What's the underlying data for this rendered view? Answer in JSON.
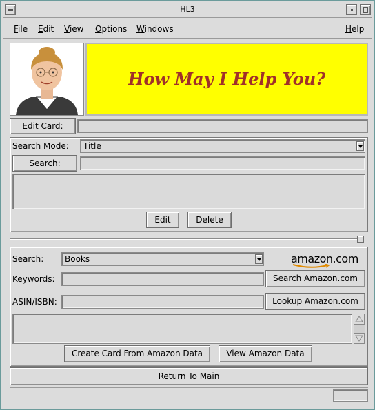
{
  "window": {
    "title": "HL3"
  },
  "menu": {
    "file": "File",
    "edit": "Edit",
    "view": "View",
    "options": "Options",
    "windows": "Windows",
    "help": "Help"
  },
  "banner": {
    "text": "How May I Help You?",
    "bg_color": "#ffff00",
    "text_color": "#a0302a"
  },
  "edit_card": {
    "button_label": "Edit Card:",
    "value": ""
  },
  "search_panel": {
    "mode_label": "Search Mode:",
    "mode_selected": "Title",
    "search_button": "Search:",
    "search_value": "",
    "edit_button": "Edit",
    "delete_button": "Delete"
  },
  "amazon_panel": {
    "search_label": "Search:",
    "search_selected": "Books",
    "keywords_label": "Keywords:",
    "keywords_value": "",
    "search_amazon_button": "Search Amazon.com",
    "asin_label": "ASIN/ISBN:",
    "asin_value": "",
    "lookup_button": "Lookup Amazon.com",
    "logo_text": "amazon.com",
    "create_card_button": "Create Card From Amazon Data",
    "view_data_button": "View Amazon Data"
  },
  "footer": {
    "return_button": "Return To Main"
  }
}
